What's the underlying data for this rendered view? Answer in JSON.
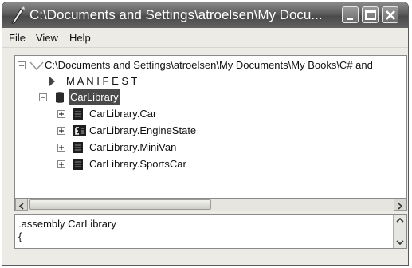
{
  "window": {
    "title": "C:\\Documents and Settings\\atroelsen\\My Docu...",
    "buttons": [
      "minimize",
      "maximize",
      "close"
    ]
  },
  "menu": [
    "File",
    "View",
    "Help"
  ],
  "tree": {
    "root_path": "C:\\Documents and Settings\\atroelsen\\My Documents\\My Books\\C# and",
    "manifest_label": "M A N I F E S T",
    "assembly": "CarLibrary",
    "types": [
      {
        "name": "CarLibrary.Car",
        "icon": "class-icon"
      },
      {
        "name": "CarLibrary.EngineState",
        "icon": "enum-icon"
      },
      {
        "name": "CarLibrary.MiniVan",
        "icon": "class-icon"
      },
      {
        "name": "CarLibrary.SportsCar",
        "icon": "class-icon"
      }
    ]
  },
  "code_lines": [
    ".assembly CarLibrary",
    "{"
  ],
  "colors": {
    "selection": "#4a4a4a",
    "titlebar": "#5b5b5b"
  }
}
